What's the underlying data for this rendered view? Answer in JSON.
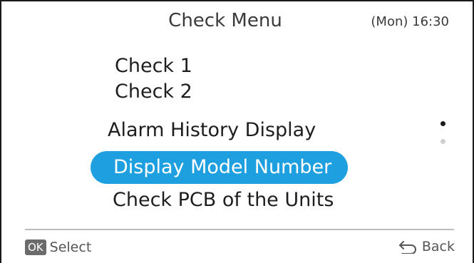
{
  "header": {
    "title": "Check Menu",
    "time": "(Mon) 16:30"
  },
  "menu": {
    "items": [
      {
        "label": "Check 1",
        "selected": false
      },
      {
        "label": "Check 2",
        "selected": false
      },
      {
        "label": "Alarm History Display",
        "selected": false
      },
      {
        "label": "Display Model Number",
        "selected": true
      },
      {
        "label": "Check PCB of the Units",
        "selected": false
      }
    ],
    "highlight_color": "#1e9fe0"
  },
  "scroll": {
    "pages": 2,
    "current_page": 1
  },
  "footer": {
    "ok_badge": "OK",
    "select_label": "Select",
    "back_label": "Back",
    "back_icon": "return-arrow-icon"
  }
}
